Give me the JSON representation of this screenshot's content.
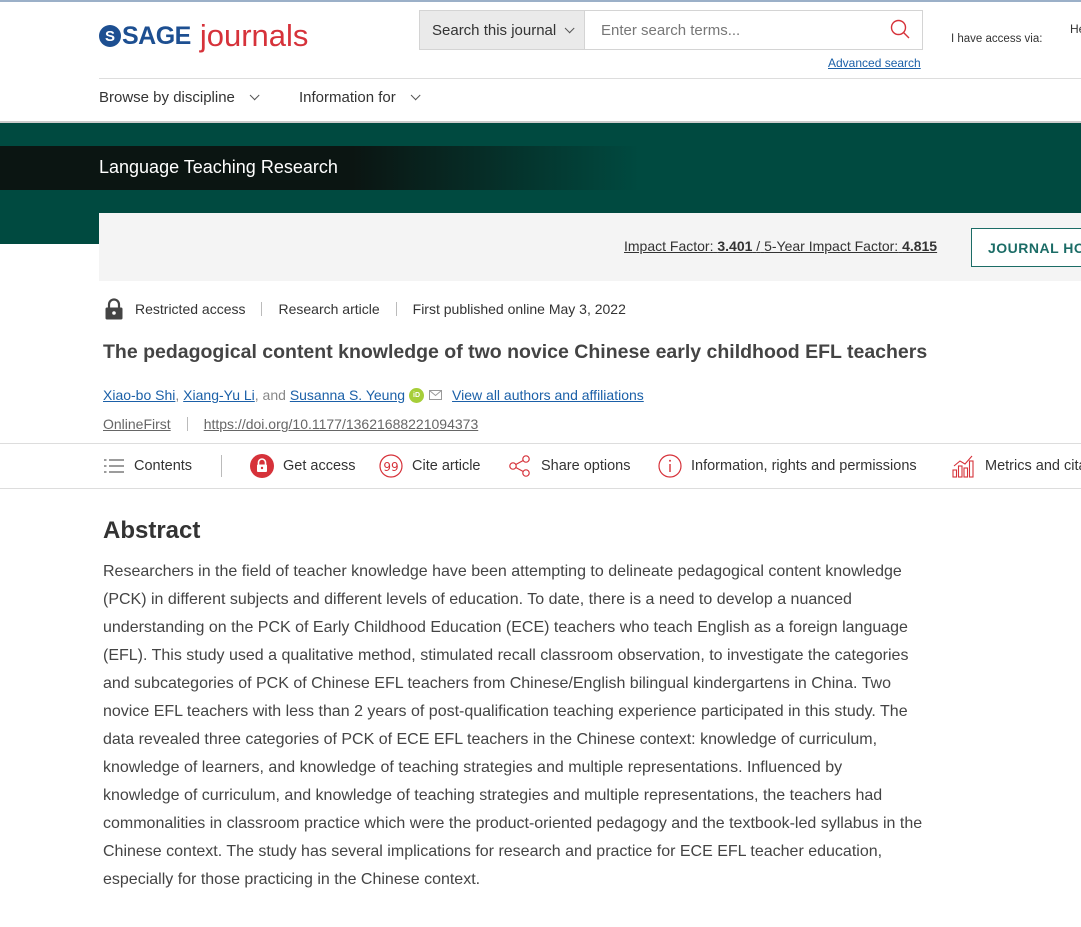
{
  "header": {
    "logo_sage": "SAGE",
    "logo_journals": "journals",
    "search_scope": "Search this journal",
    "search_placeholder": "Enter search terms...",
    "advanced_search": "Advanced search",
    "access_via": "I have access via:",
    "cut_text": "He"
  },
  "nav": {
    "browse": "Browse by discipline",
    "info": "Information for"
  },
  "banner": {
    "journal_title": "Language Teaching Research",
    "impact_label": "Impact Factor:",
    "impact_value": "3.401",
    "impact_sep": "/",
    "five_year_label": "5-Year Impact Factor:",
    "five_year_value": "4.815",
    "journal_home": "JOURNAL HOMEPAGE"
  },
  "article": {
    "access": "Restricted access",
    "type": "Research article",
    "published": "First published online May 3, 2022",
    "title": "The pedagogical content knowledge of two novice Chinese early childhood EFL teachers",
    "authors": [
      "Xiao-bo Shi",
      "Xiang-Yu Li",
      "Susanna S. Yeung"
    ],
    "author_sep": ",",
    "author_and": ", and",
    "view_all": "View all authors and affiliations",
    "online_first": "OnlineFirst",
    "doi": "https://doi.org/10.1177/13621688221094373"
  },
  "toolbar": {
    "contents": "Contents",
    "get_access": "Get access",
    "cite": "Cite article",
    "share": "Share options",
    "info": "Information, rights and permissions",
    "metrics": "Metrics and citations"
  },
  "abstract": {
    "heading": "Abstract",
    "body": "Researchers in the field of teacher knowledge have been attempting to delineate pedagogical content knowledge (PCK) in different subjects and different levels of education. To date, there is a need to develop a nuanced understanding on the PCK of Early Childhood Education (ECE) teachers who teach English as a foreign language (EFL). This study used a qualitative method, stimulated recall classroom observation, to investigate the categories and subcategories of PCK of Chinese EFL teachers from Chinese/English bilingual kindergartens in China. Two novice EFL teachers with less than 2 years of post-qualification teaching experience participated in this study. The data revealed three categories of PCK of ECE EFL teachers in the Chinese context: knowledge of curriculum, knowledge of learners, and knowledge of teaching strategies and multiple representations. Influenced by knowledge of curriculum, and knowledge of teaching strategies and multiple representations, the teachers had commonalities in classroom practice which were the product-oriented pedagogy and the textbook-led syllabus in the Chinese context. The study has several implications for research and practice for ECE EFL teacher education, especially for those practicing in the Chinese context."
  },
  "colors": {
    "banner_green": "#004a40",
    "link_blue": "#1b60a8",
    "sage_blue": "#1d4f91",
    "journals_red": "#d6323a",
    "access_red": "#d6323a",
    "orcid_green": "#a6ce39"
  }
}
